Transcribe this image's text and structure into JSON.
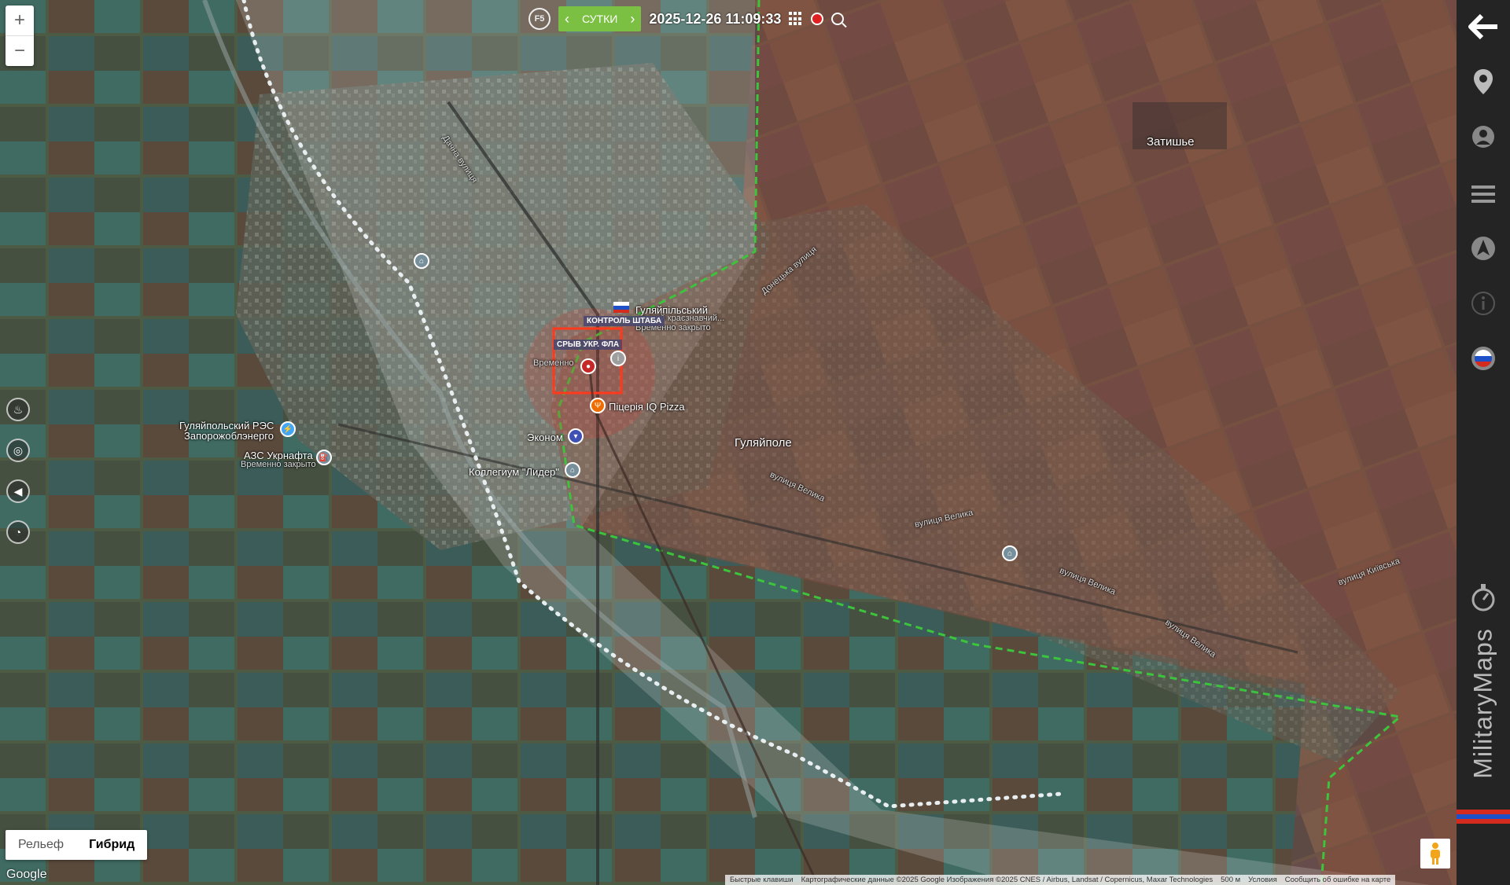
{
  "toolbar": {
    "f5_label": "F5",
    "period_label": "СУТКИ",
    "prev_arrow": "‹",
    "next_arrow": "›",
    "datetime": "2025-12-26 11:09:33"
  },
  "zoom": {
    "in_label": "+",
    "out_label": "−"
  },
  "map_labels": {
    "zatyshshe": "Затишье",
    "huliaipole": "Гуляйполе",
    "hq_control": "КОНТРОЛЬ ШТАБА",
    "hq_breakdown": "СРЫВ УКР. ФЛА",
    "huliaipilskyi": "Гуляйпільський",
    "kraevedcheskiy": "...онний краєзнавчий...",
    "temporarily_closed": "Временно закрыто",
    "temporarily_closed_short": "Временно",
    "pizzeria": "Піцерія IQ Pizza",
    "econom": "Эконом",
    "college": "Коллегиум \"Лидер\"",
    "res": "Гуляйпольский РЭС",
    "zaporozhoblenergo": "Запорожоблэнерго",
    "azs": "АЗС Укрнафта",
    "azs_closed": "Временно закрыто",
    "dachna": "Дачна вулиця",
    "velyka1": "вулиця Велика",
    "velyka2": "вулиця Велика",
    "velyka3": "вулиця Велика",
    "velyka4": "вулиця Велика",
    "donetska": "Донецька вулиця",
    "kyivska": "вулиця Київська"
  },
  "map_types": {
    "relief": "Рельеф",
    "hybrid": "Гибрид",
    "active": "hybrid"
  },
  "google_logo": "Google",
  "attribution": {
    "shortcuts": "Быстрые клавиши",
    "data": "Картографические данные ©2025 Google Изображения ©2025 CNES / Airbus, Landsat / Copernicus, Maxar Technologies",
    "scale": "500 м",
    "terms": "Условия",
    "report": "Сообщить об ошибке на карте"
  },
  "brand": "MilitaryMaps",
  "icons": {
    "back": "arrow-left-icon",
    "location": "location-pin-icon",
    "user": "user-icon",
    "menu": "menu-icon",
    "navigate": "navigate-icon",
    "info": "info-icon",
    "flag": "russia-flag-icon",
    "compass": "compass-icon",
    "fire": "fire-icon",
    "target": "target-icon",
    "sound": "speaker-icon",
    "gauge": "gauge-icon",
    "pegman": "pegman-icon"
  },
  "colors": {
    "green_line": "#3cc43c",
    "red_zone": "#d8342c",
    "brown_zone": "#8b4a3a",
    "period_bg": "#7cc043",
    "sidebar_bg": "#242424"
  }
}
